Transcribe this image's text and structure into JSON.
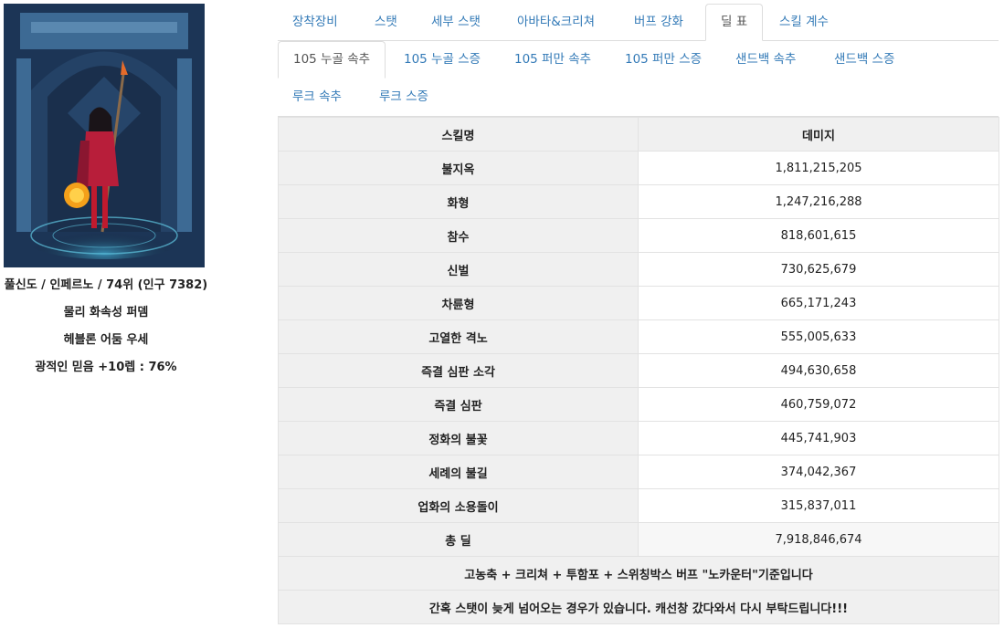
{
  "character": {
    "line1": "풀신도 / 인페르노 / 74위 (인구 7382)",
    "line2": "물리 화속성 퍼뎀",
    "line3": "헤블론 어둠 우세",
    "line4": "광적인 믿음 +10렙 : 76%"
  },
  "tabs_main": [
    "장착장비",
    "스탯",
    "세부 스탯",
    "아바타&크리쳐",
    "버프 강화",
    "딜 표",
    "스킬 계수"
  ],
  "tabs_sub_row1": [
    "105 누골 속추",
    "105 누골 스증",
    "105 퍼만 속추",
    "105 퍼만 스증",
    "샌드백 속추",
    "샌드백 스증"
  ],
  "tabs_sub_row2": [
    "루크 속추",
    "루크 스증"
  ],
  "table": {
    "headers": [
      "스킬명",
      "데미지"
    ],
    "rows": [
      {
        "name": "불지옥",
        "value": "1,811,215,205"
      },
      {
        "name": "화형",
        "value": "1,247,216,288"
      },
      {
        "name": "참수",
        "value": "818,601,615"
      },
      {
        "name": "신벌",
        "value": "730,625,679"
      },
      {
        "name": "차륜형",
        "value": "665,171,243"
      },
      {
        "name": "고열한 격노",
        "value": "555,005,633"
      },
      {
        "name": "즉결 심판 소각",
        "value": "494,630,658"
      },
      {
        "name": "즉결 심판",
        "value": "460,759,072"
      },
      {
        "name": "정화의 불꽃",
        "value": "445,741,903"
      },
      {
        "name": "세례의 불길",
        "value": "374,042,367"
      },
      {
        "name": "업화의 소용돌이",
        "value": "315,837,011"
      },
      {
        "name": "총 딜",
        "value": "7,918,846,674"
      }
    ],
    "note1": "고농축 + 크리쳐 + 투함포 + 스위칭박스 버프 \"노카운터\"기준입니다",
    "note2": "간혹 스탯이 늦게 넘어오는 경우가 있습니다. 캐선창 갔다와서 다시 부탁드립니다!!!"
  }
}
